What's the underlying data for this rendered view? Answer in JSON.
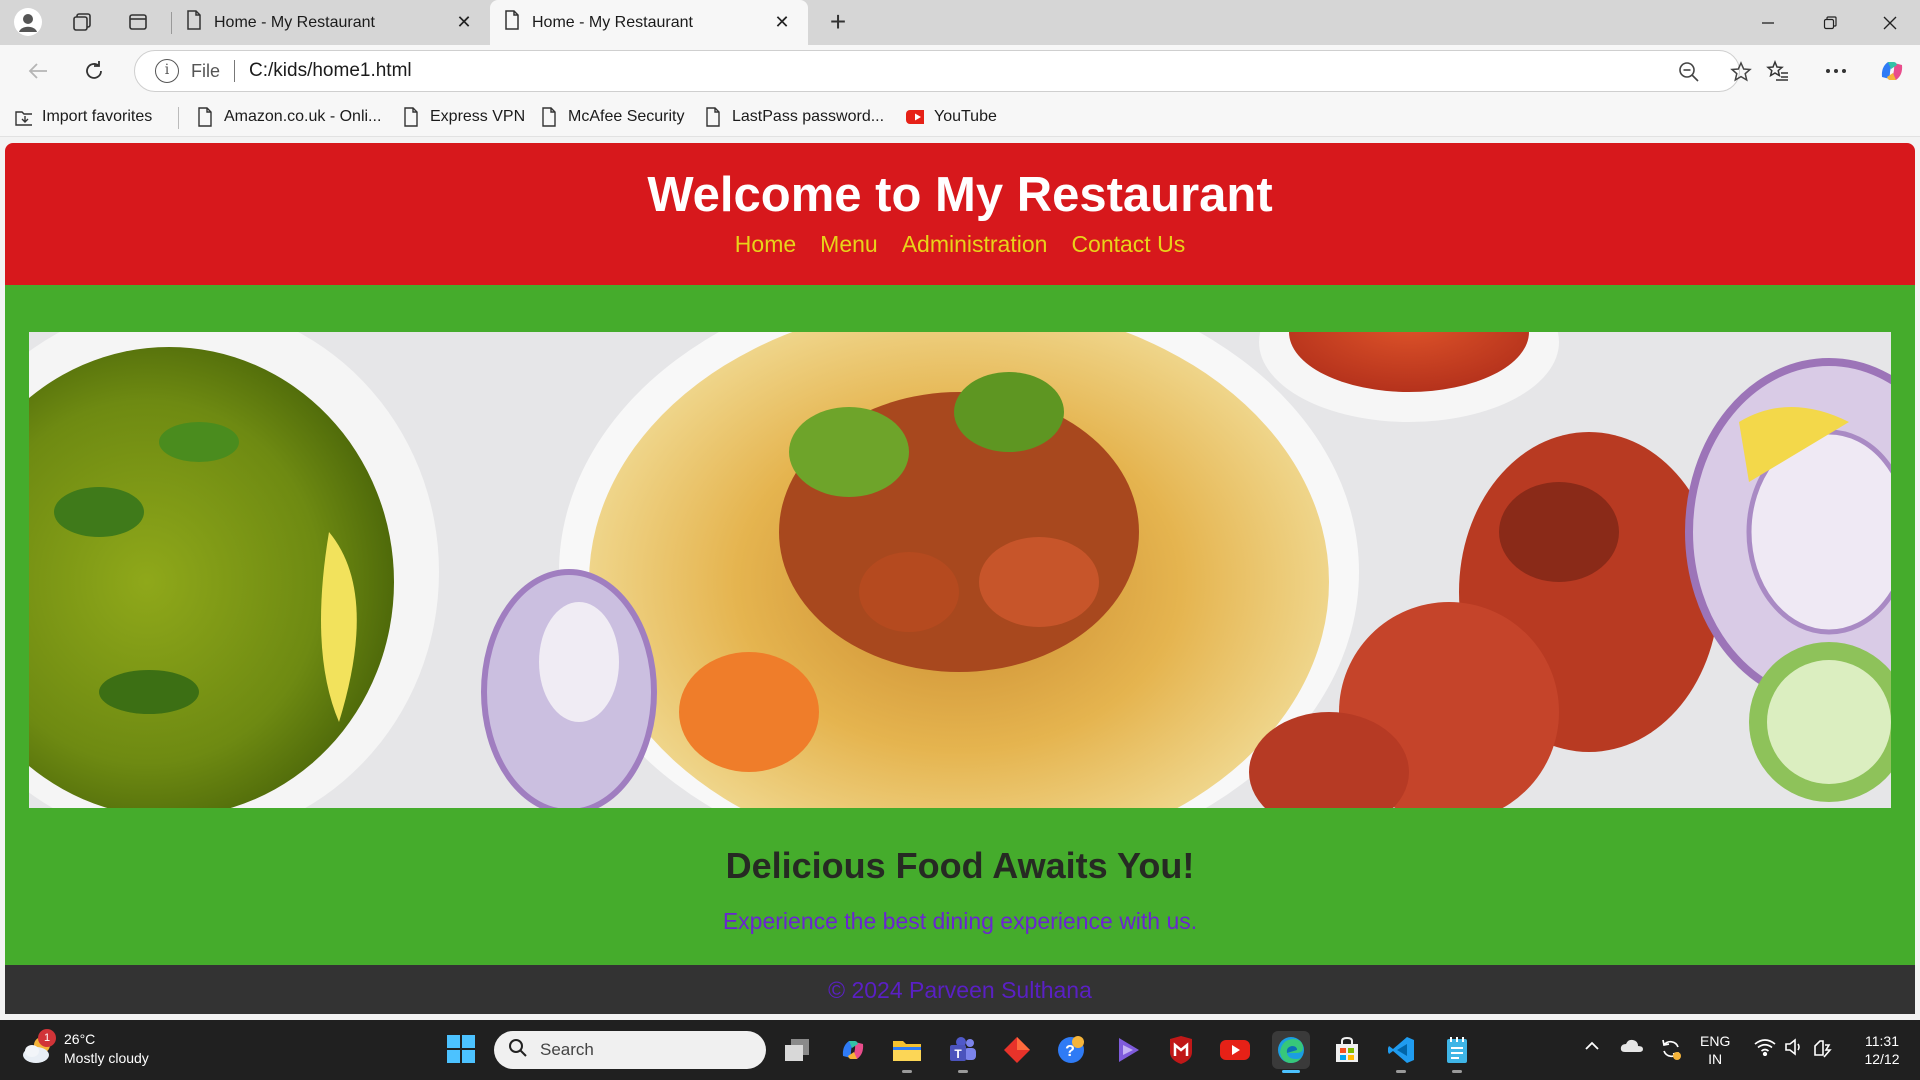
{
  "browser": {
    "tabs": [
      {
        "title": "Home - My Restaurant",
        "active": false
      },
      {
        "title": "Home - My Restaurant",
        "active": true
      }
    ],
    "address": {
      "scheme_label": "File",
      "url": "C:/kids/home1.html"
    },
    "bookmarks": [
      {
        "label": "Import favorites",
        "icon": "import-icon"
      },
      {
        "label": "Amazon.co.uk - Onli...",
        "icon": "page-icon"
      },
      {
        "label": "Express VPN",
        "icon": "page-icon"
      },
      {
        "label": "McAfee Security",
        "icon": "page-icon"
      },
      {
        "label": "LastPass password...",
        "icon": "page-icon"
      },
      {
        "label": "YouTube",
        "icon": "youtube-icon"
      }
    ]
  },
  "page": {
    "header": {
      "title": "Welcome to My Restaurant",
      "nav": [
        "Home",
        "Menu",
        "Administration",
        "Contact Us"
      ]
    },
    "hero": {
      "image": "food-platter-image"
    },
    "main": {
      "heading": "Delicious Food Awaits You!",
      "text": "Experience the best dining experience with us."
    },
    "footer": {
      "text": "© 2024 Parveen Sulthana"
    },
    "colors": {
      "header_bg": "#d7181c",
      "nav_link": "#e8d31a",
      "main_bg": "#45ac2c",
      "paragraph": "#6a25d1",
      "footer_bg": "#333333",
      "footer_text": "#5a20c4"
    }
  },
  "taskbar": {
    "weather": {
      "badge": "1",
      "temp": "26°C",
      "condition": "Mostly cloudy"
    },
    "search_placeholder": "Search",
    "tray": {
      "lang_top": "ENG",
      "lang_bottom": "IN",
      "time": "11:31",
      "date": "12/12"
    }
  }
}
